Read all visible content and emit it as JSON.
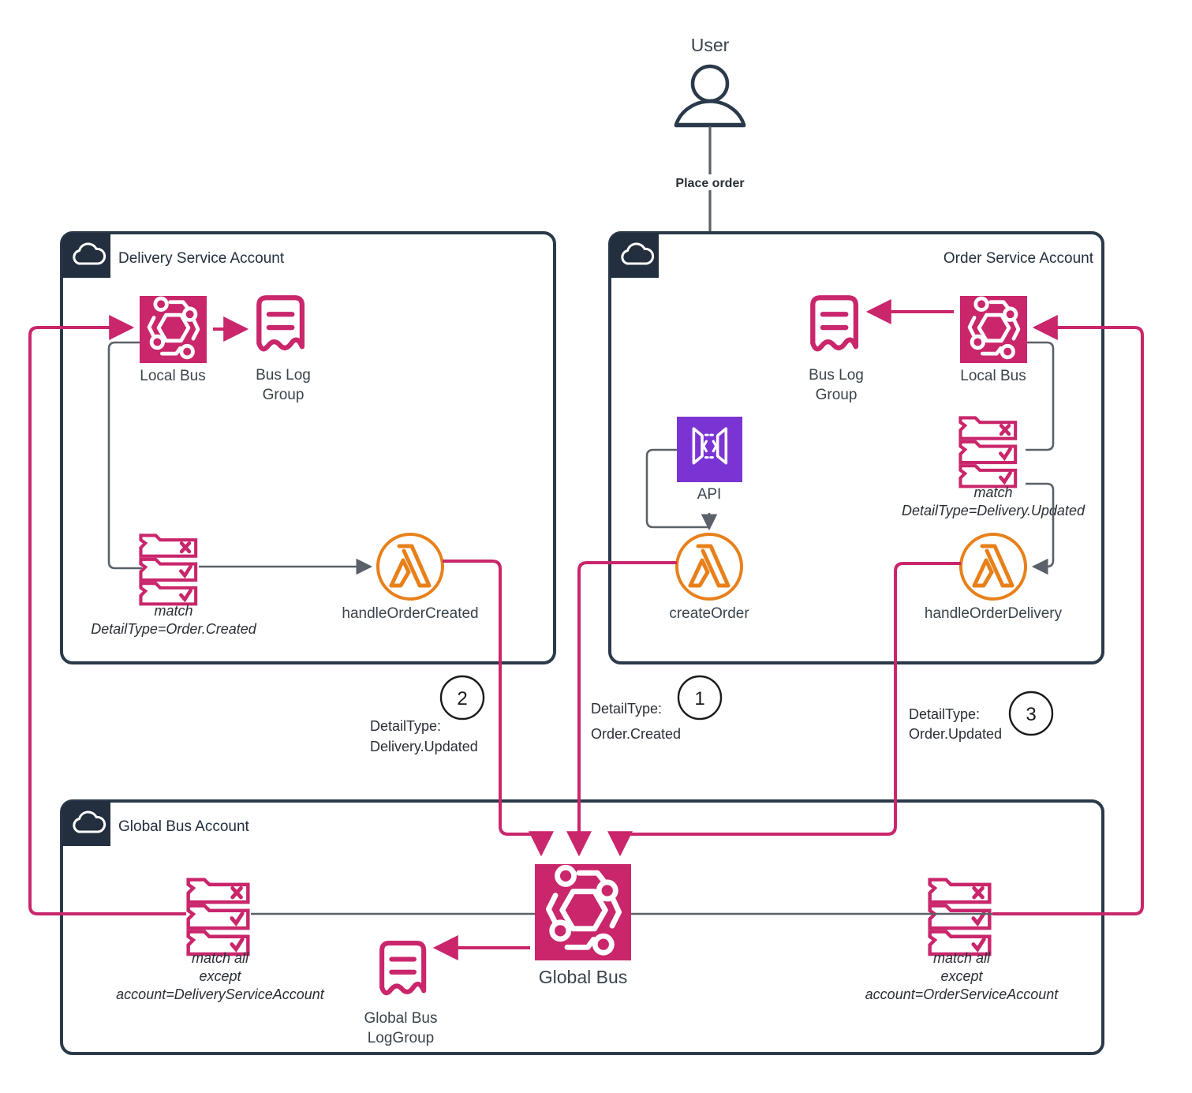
{
  "diagram": {
    "title": "EventBridge cross-account event bus architecture",
    "colors": {
      "eventbridge_pink": "#C9266B",
      "lambda_orange": "#E8801A",
      "api_purple": "#7A34D4",
      "account_border": "#2a3a4a",
      "account_header": "#232f3e",
      "connector_gray": "#5a6168",
      "text_dark": "#3b444c"
    }
  },
  "actor": {
    "label": "User",
    "action_label": "Place order"
  },
  "accounts": [
    {
      "id": "delivery",
      "title": "Delivery Service Account",
      "icon": "cloud-icon",
      "nodes": [
        {
          "id": "delivery-local-bus",
          "label": "Local Bus",
          "icon": "eventbridge-icon"
        },
        {
          "id": "delivery-bus-log-group",
          "label": "Bus Log\nGroup",
          "line1": "Bus Log",
          "line2": "Group",
          "icon": "cloudwatch-log-group-icon"
        },
        {
          "id": "delivery-rule",
          "icon": "eventbridge-rule-icon",
          "line1": "match",
          "line2": "DetailType=Order.Created"
        },
        {
          "id": "handle-order-created",
          "label": "handleOrderCreated",
          "icon": "lambda-icon"
        }
      ]
    },
    {
      "id": "order",
      "title": "Order Service Account",
      "icon": "cloud-icon",
      "nodes": [
        {
          "id": "order-bus-log-group",
          "line1": "Bus Log",
          "line2": "Group",
          "icon": "cloudwatch-log-group-icon"
        },
        {
          "id": "order-local-bus",
          "label": "Local Bus",
          "icon": "eventbridge-icon"
        },
        {
          "id": "order-rule",
          "icon": "eventbridge-rule-icon",
          "line1": "match",
          "line2": "DetailType=Delivery.Updated"
        },
        {
          "id": "api",
          "label": "API",
          "icon": "api-gateway-icon"
        },
        {
          "id": "create-order",
          "label": "createOrder",
          "icon": "lambda-icon"
        },
        {
          "id": "handle-order-delivery",
          "label": "handleOrderDelivery",
          "icon": "lambda-icon"
        }
      ]
    },
    {
      "id": "global",
      "title": "Global Bus Account",
      "icon": "cloud-icon",
      "nodes": [
        {
          "id": "global-rule-delivery",
          "icon": "eventbridge-rule-icon",
          "line1": "match all",
          "line2": "except",
          "line3": "account=DeliveryServiceAccount"
        },
        {
          "id": "global-bus-log-group",
          "line1": "Global Bus",
          "line2": "LogGroup",
          "icon": "cloudwatch-log-group-icon"
        },
        {
          "id": "global-bus",
          "label": "Global Bus",
          "icon": "eventbridge-icon"
        },
        {
          "id": "global-rule-order",
          "icon": "eventbridge-rule-icon",
          "line1": "match all",
          "line2": "except",
          "line3": "account=OrderServiceAccount"
        }
      ]
    }
  ],
  "steps": [
    {
      "number": "1",
      "line1": "DetailType:",
      "line2": "Order.Created"
    },
    {
      "number": "2",
      "line1": "DetailType:",
      "line2": "Delivery.Updated"
    },
    {
      "number": "3",
      "line1": "DetailType:",
      "line2": "Order.Updated"
    }
  ]
}
